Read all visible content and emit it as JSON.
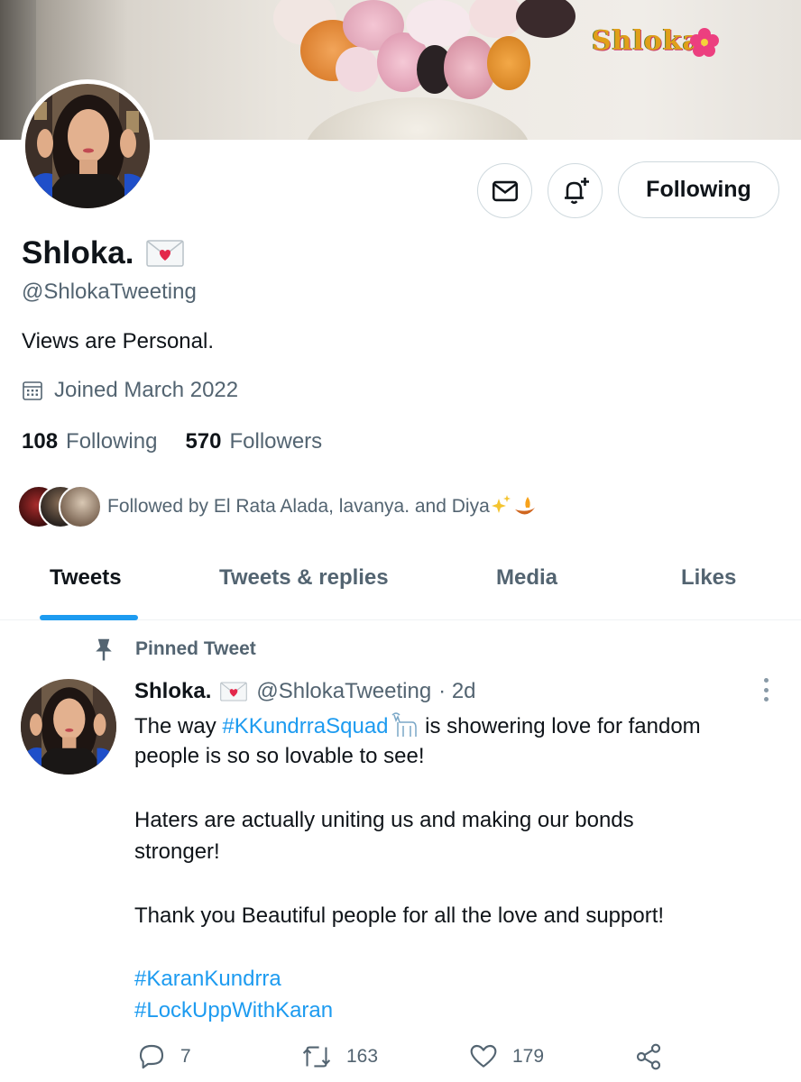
{
  "banner": {
    "watermark": "Shloka"
  },
  "profile": {
    "display_name": "Shloka.",
    "handle": "@ShlokaTweeting",
    "bio": "Views are Personal.",
    "joined": "Joined March 2022",
    "following_count": "108",
    "following_label": "Following",
    "followers_count": "570",
    "followers_label": "Followers",
    "followed_by": "Followed by El Rata Alada, lavanya. and Diya",
    "follow_button": "Following"
  },
  "tabs": [
    {
      "label": "Tweets",
      "active": true
    },
    {
      "label": "Tweets & replies",
      "active": false
    },
    {
      "label": "Media",
      "active": false
    },
    {
      "label": "Likes",
      "active": false
    }
  ],
  "pinned_tweet": {
    "pinned_label": "Pinned Tweet",
    "author_name": "Shloka.",
    "author_handle": "@ShlokaTweeting",
    "time": "· 2d",
    "line1_prefix": "The way ",
    "line1_hashtag": "#KKundrraSquad",
    "line1_suffix": " is showering love for fandom",
    "line2": "people is so so lovable to see!",
    "line3": "Haters are actually uniting us and making our bonds",
    "line4": "stronger!",
    "line5": "Thank you Beautiful people for all the love and support!",
    "hashtag1": "#KaranKundrra",
    "hashtag2": "#LockUppWithKaran",
    "replies": "7",
    "retweets": "163",
    "likes": "179"
  },
  "colors": {
    "accent": "#1d9bf0",
    "secondary_text": "#536471",
    "border": "#cfd9de"
  }
}
